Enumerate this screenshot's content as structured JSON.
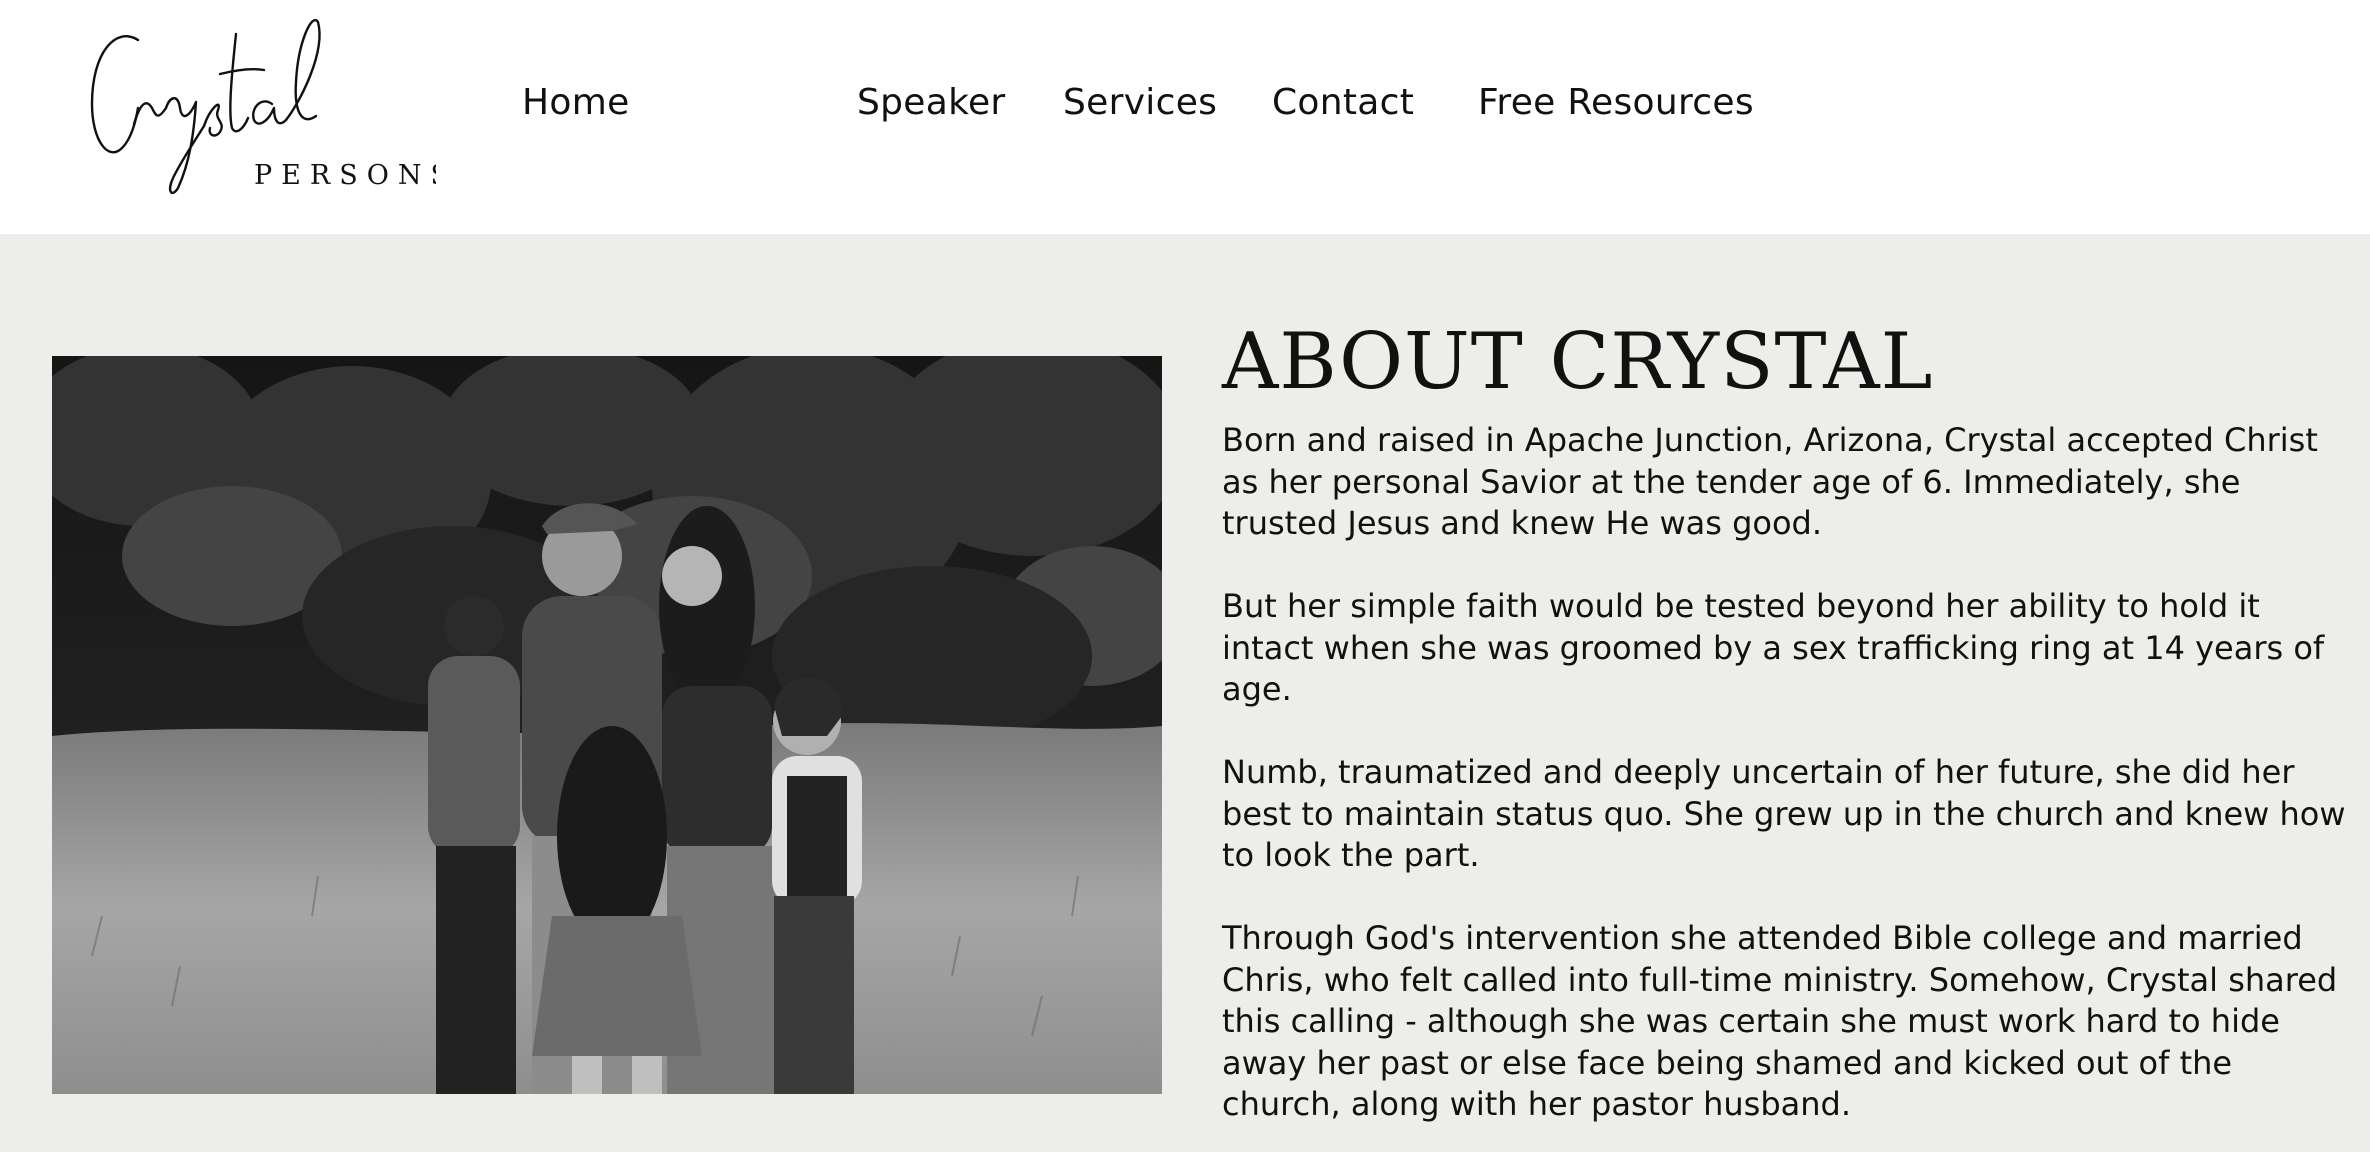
{
  "logo": {
    "script_text": "Crystal",
    "sub_text": "PERSONS"
  },
  "nav": {
    "items": [
      {
        "label": "Home"
      },
      {
        "label": "Speaker"
      },
      {
        "label": "Services"
      },
      {
        "label": "Contact"
      },
      {
        "label": "Free Resources"
      }
    ]
  },
  "about": {
    "title": "ABOUT CRYSTAL",
    "paragraphs": [
      "Born and raised in Apache Junction, Arizona, Crystal accepted Christ as her personal Savior at the tender age of 6. Immediately, she trusted Jesus and knew He was good.",
      "But her simple faith would be tested beyond her ability to hold it intact when she was groomed by a sex trafficking ring at 14 years of age.",
      "Numb, traumatized and deeply uncertain of her future, she did her best to maintain status quo. She grew up in the church and knew how to look the part.",
      "Through God's intervention she attended Bible college and married Chris, who felt called into full-time ministry. Somehow, Crystal shared this calling - although she was certain she must work hard to hide away her past or else face being shamed and kicked out of the church, along with her pastor husband."
    ]
  },
  "colors": {
    "background_band": "#edeeea",
    "header_background": "#ffffff",
    "text": "#111111"
  }
}
